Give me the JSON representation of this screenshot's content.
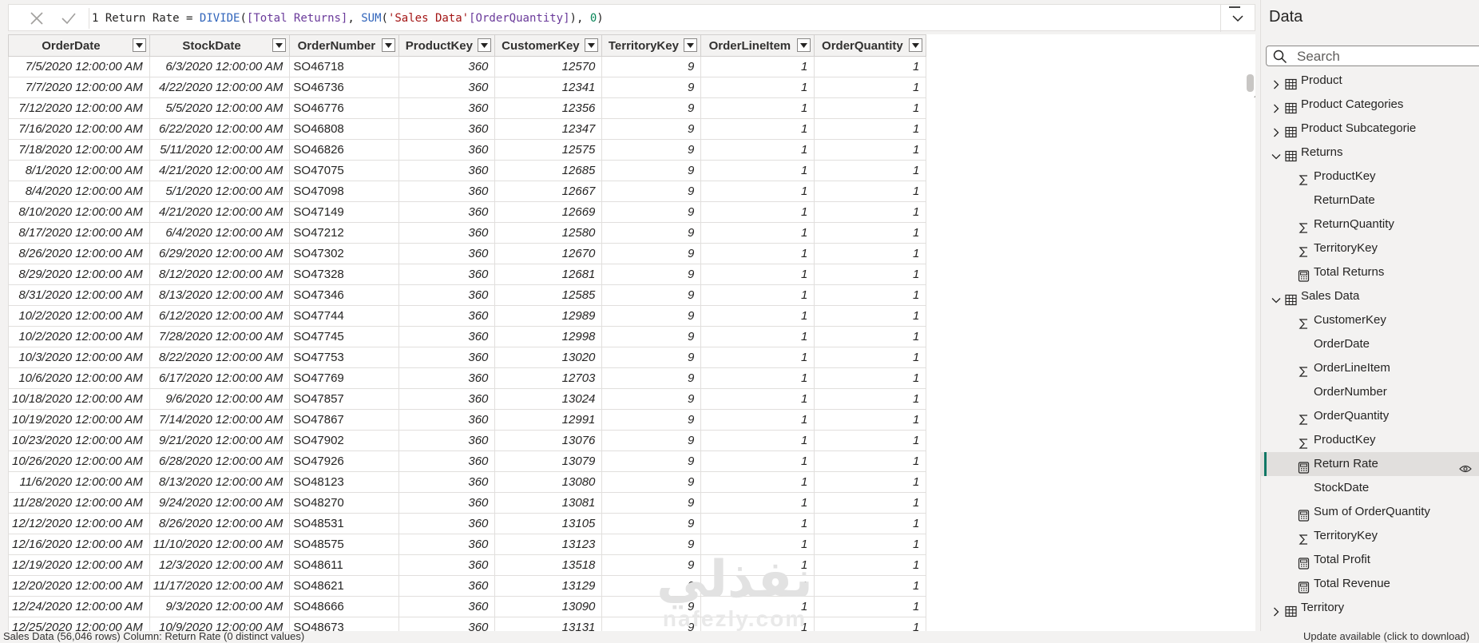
{
  "formula_bar": {
    "line_number": "1",
    "measure_name": "Return Rate",
    "equals": "=",
    "function": "DIVIDE",
    "open_paren": "(",
    "measure_ref": "[Total Returns]",
    "comma1": ", ",
    "sum_fn": "SUM",
    "sum_open": "(",
    "table_ref": "'Sales Data'",
    "column_ref": "[OrderQuantity]",
    "sum_close": ")",
    "comma2": ", ",
    "alt_value": "0",
    "close_paren": ")"
  },
  "grid": {
    "columns": [
      "OrderDate",
      "StockDate",
      "OrderNumber",
      "ProductKey",
      "CustomerKey",
      "TerritoryKey",
      "OrderLineItem",
      "OrderQuantity"
    ],
    "rows": [
      [
        "7/5/2020 12:00:00 AM",
        "6/3/2020 12:00:00 AM",
        "SO46718",
        "360",
        "12570",
        "9",
        "1",
        "1"
      ],
      [
        "7/7/2020 12:00:00 AM",
        "4/22/2020 12:00:00 AM",
        "SO46736",
        "360",
        "12341",
        "9",
        "1",
        "1"
      ],
      [
        "7/12/2020 12:00:00 AM",
        "5/5/2020 12:00:00 AM",
        "SO46776",
        "360",
        "12356",
        "9",
        "1",
        "1"
      ],
      [
        "7/16/2020 12:00:00 AM",
        "6/22/2020 12:00:00 AM",
        "SO46808",
        "360",
        "12347",
        "9",
        "1",
        "1"
      ],
      [
        "7/18/2020 12:00:00 AM",
        "5/11/2020 12:00:00 AM",
        "SO46826",
        "360",
        "12575",
        "9",
        "1",
        "1"
      ],
      [
        "8/1/2020 12:00:00 AM",
        "4/21/2020 12:00:00 AM",
        "SO47075",
        "360",
        "12685",
        "9",
        "1",
        "1"
      ],
      [
        "8/4/2020 12:00:00 AM",
        "5/1/2020 12:00:00 AM",
        "SO47098",
        "360",
        "12667",
        "9",
        "1",
        "1"
      ],
      [
        "8/10/2020 12:00:00 AM",
        "4/21/2020 12:00:00 AM",
        "SO47149",
        "360",
        "12669",
        "9",
        "1",
        "1"
      ],
      [
        "8/17/2020 12:00:00 AM",
        "6/4/2020 12:00:00 AM",
        "SO47212",
        "360",
        "12580",
        "9",
        "1",
        "1"
      ],
      [
        "8/26/2020 12:00:00 AM",
        "6/29/2020 12:00:00 AM",
        "SO47302",
        "360",
        "12670",
        "9",
        "1",
        "1"
      ],
      [
        "8/29/2020 12:00:00 AM",
        "8/12/2020 12:00:00 AM",
        "SO47328",
        "360",
        "12681",
        "9",
        "1",
        "1"
      ],
      [
        "8/31/2020 12:00:00 AM",
        "8/13/2020 12:00:00 AM",
        "SO47346",
        "360",
        "12585",
        "9",
        "1",
        "1"
      ],
      [
        "10/2/2020 12:00:00 AM",
        "6/12/2020 12:00:00 AM",
        "SO47744",
        "360",
        "12989",
        "9",
        "1",
        "1"
      ],
      [
        "10/2/2020 12:00:00 AM",
        "7/28/2020 12:00:00 AM",
        "SO47745",
        "360",
        "12998",
        "9",
        "1",
        "1"
      ],
      [
        "10/3/2020 12:00:00 AM",
        "8/22/2020 12:00:00 AM",
        "SO47753",
        "360",
        "13020",
        "9",
        "1",
        "1"
      ],
      [
        "10/6/2020 12:00:00 AM",
        "6/17/2020 12:00:00 AM",
        "SO47769",
        "360",
        "12703",
        "9",
        "1",
        "1"
      ],
      [
        "10/18/2020 12:00:00 AM",
        "9/6/2020 12:00:00 AM",
        "SO47857",
        "360",
        "13024",
        "9",
        "1",
        "1"
      ],
      [
        "10/19/2020 12:00:00 AM",
        "7/14/2020 12:00:00 AM",
        "SO47867",
        "360",
        "12991",
        "9",
        "1",
        "1"
      ],
      [
        "10/23/2020 12:00:00 AM",
        "9/21/2020 12:00:00 AM",
        "SO47902",
        "360",
        "13076",
        "9",
        "1",
        "1"
      ],
      [
        "10/26/2020 12:00:00 AM",
        "6/28/2020 12:00:00 AM",
        "SO47926",
        "360",
        "13079",
        "9",
        "1",
        "1"
      ],
      [
        "11/6/2020 12:00:00 AM",
        "8/13/2020 12:00:00 AM",
        "SO48123",
        "360",
        "13080",
        "9",
        "1",
        "1"
      ],
      [
        "11/28/2020 12:00:00 AM",
        "9/24/2020 12:00:00 AM",
        "SO48270",
        "360",
        "13081",
        "9",
        "1",
        "1"
      ],
      [
        "12/12/2020 12:00:00 AM",
        "8/26/2020 12:00:00 AM",
        "SO48531",
        "360",
        "13105",
        "9",
        "1",
        "1"
      ],
      [
        "12/16/2020 12:00:00 AM",
        "11/10/2020 12:00:00 AM",
        "SO48575",
        "360",
        "13123",
        "9",
        "1",
        "1"
      ],
      [
        "12/19/2020 12:00:00 AM",
        "12/3/2020 12:00:00 AM",
        "SO48611",
        "360",
        "13518",
        "9",
        "1",
        "1"
      ],
      [
        "12/20/2020 12:00:00 AM",
        "11/17/2020 12:00:00 AM",
        "SO48621",
        "360",
        "13129",
        "9",
        "1",
        "1"
      ],
      [
        "12/24/2020 12:00:00 AM",
        "9/3/2020 12:00:00 AM",
        "SO48666",
        "360",
        "13090",
        "9",
        "1",
        "1"
      ],
      [
        "12/25/2020 12:00:00 AM",
        "10/9/2020 12:00:00 AM",
        "SO48673",
        "360",
        "13131",
        "9",
        "1",
        "1"
      ]
    ]
  },
  "data_pane": {
    "title": "Data",
    "search_placeholder": "Search",
    "items": [
      {
        "label": "Product",
        "type": "table",
        "level": 0,
        "chevron": "right"
      },
      {
        "label": "Product Categories",
        "type": "table",
        "level": 0,
        "chevron": "right"
      },
      {
        "label": "Product Subcategorie",
        "type": "table",
        "level": 0,
        "chevron": "right"
      },
      {
        "label": "Returns",
        "type": "table",
        "level": 0,
        "chevron": "down"
      },
      {
        "label": "ProductKey",
        "type": "sum",
        "level": 1
      },
      {
        "label": "ReturnDate",
        "type": "none",
        "level": 1
      },
      {
        "label": "ReturnQuantity",
        "type": "sum",
        "level": 1
      },
      {
        "label": "TerritoryKey",
        "type": "sum",
        "level": 1
      },
      {
        "label": "Total Returns",
        "type": "measure",
        "level": 1
      },
      {
        "label": "Sales Data",
        "type": "table",
        "level": 0,
        "chevron": "down"
      },
      {
        "label": "CustomerKey",
        "type": "sum",
        "level": 1
      },
      {
        "label": "OrderDate",
        "type": "none",
        "level": 1
      },
      {
        "label": "OrderLineItem",
        "type": "sum",
        "level": 1
      },
      {
        "label": "OrderNumber",
        "type": "none",
        "level": 1
      },
      {
        "label": "OrderQuantity",
        "type": "sum",
        "level": 1
      },
      {
        "label": "ProductKey",
        "type": "sum",
        "level": 1
      },
      {
        "label": "Return Rate",
        "type": "measure",
        "level": 1,
        "selected": true
      },
      {
        "label": "StockDate",
        "type": "none",
        "level": 1
      },
      {
        "label": "Sum of OrderQuantity",
        "type": "measure",
        "level": 1
      },
      {
        "label": "TerritoryKey",
        "type": "sum",
        "level": 1
      },
      {
        "label": "Total Profit",
        "type": "measure",
        "level": 1
      },
      {
        "label": "Total Revenue",
        "type": "measure",
        "level": 1
      },
      {
        "label": "Territory",
        "type": "table",
        "level": 0,
        "chevron": "right"
      }
    ]
  },
  "watermark": {
    "arabic": "نفذلي",
    "latin": "nafezly.com"
  },
  "status_bar": {
    "left": "Sales Data (56,046 rows) Column: Return Rate (0 distinct values)",
    "right": "Update available (click to download)"
  },
  "colors": {
    "accent": "#117865",
    "header_bg": "#f3f2f1",
    "grid_line": "#e1dfdd"
  }
}
